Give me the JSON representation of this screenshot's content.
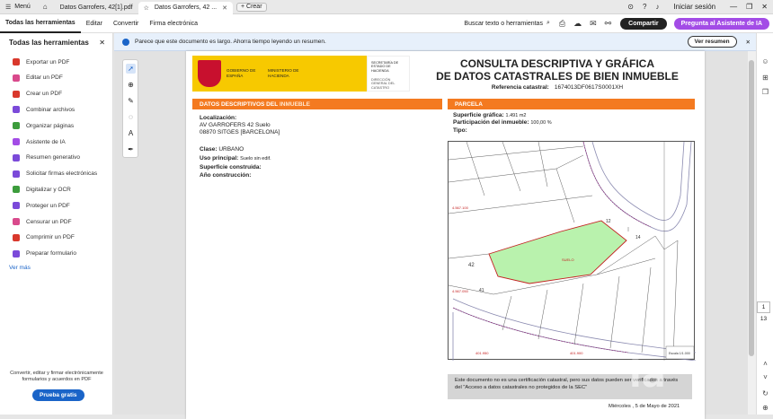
{
  "tabbar": {
    "menu_label": "Menú",
    "tabs": [
      {
        "label": "Datos Garrofers, 42[1].pdf"
      },
      {
        "label": "Datos Garrofers, 42 ..."
      }
    ],
    "new_tab_label": "+ Crear",
    "signin_label": "Iniciar sesión"
  },
  "toolbar": {
    "menu_items": [
      "Todas las herramientas",
      "Editar",
      "Convertir",
      "Firma electrónica"
    ],
    "search_label": "Buscar texto o herramientas",
    "share_label": "Compartir",
    "ai_label": "Pregunta al Asistente de IA"
  },
  "sidebar": {
    "title": "Todas las herramientas",
    "items": [
      {
        "label": "Exportar un PDF",
        "icon": "export-pdf-icon",
        "color": "#d9382c"
      },
      {
        "label": "Editar un PDF",
        "icon": "edit-pdf-icon",
        "color": "#d94a8c"
      },
      {
        "label": "Crear un PDF",
        "icon": "create-pdf-icon",
        "color": "#d9382c"
      },
      {
        "label": "Combinar archivos",
        "icon": "combine-icon",
        "color": "#7b4ad9"
      },
      {
        "label": "Organizar páginas",
        "icon": "organize-icon",
        "color": "#3c9c3c"
      },
      {
        "label": "Asistente de IA",
        "icon": "ai-assistant-icon",
        "color": "#a34ce6"
      },
      {
        "label": "Resumen generativo",
        "icon": "summary-icon",
        "color": "#7b4ad9"
      },
      {
        "label": "Solicitar firmas electrónicas",
        "icon": "request-sign-icon",
        "color": "#7b4ad9"
      },
      {
        "label": "Digitalizar y OCR",
        "icon": "scan-ocr-icon",
        "color": "#3c9c3c"
      },
      {
        "label": "Proteger un PDF",
        "icon": "protect-icon",
        "color": "#7b4ad9"
      },
      {
        "label": "Censurar un PDF",
        "icon": "redact-icon",
        "color": "#d94a8c"
      },
      {
        "label": "Comprimir un PDF",
        "icon": "compress-icon",
        "color": "#d9382c"
      },
      {
        "label": "Preparar formulario",
        "icon": "form-icon",
        "color": "#7b4ad9"
      }
    ],
    "more_label": "Ver más",
    "promo_text": "Convertir, editar y firmar electrónicamente formularios y acuerdos en PDF",
    "trial_label": "Prueba gratis"
  },
  "notice": {
    "text": "Parece que este documento es largo. Ahorra tiempo leyendo un resumen.",
    "button_label": "Ver resumen"
  },
  "document": {
    "logo_gov": "GOBIERNO DE ESPAÑA",
    "logo_min": "MINISTERIO DE HACIENDA",
    "logo_sec": "SECRETARÍA DE ESTADO DE HACIENDA",
    "logo_dir": "DIRECCIÓN GENERAL DEL CATASTRO",
    "title_line1": "CONSULTA DESCRIPTIVA Y GRÁFICA",
    "title_line2": "DE DATOS CATASTRALES DE BIEN INMUEBLE",
    "ref_label": "Referencia catastral:",
    "ref_value": "1674013DF0617S0001XH",
    "section_left_a": "DATOS DESCRIPTIVOS DEL",
    "section_left_b": "INMUEBLE",
    "section_right": "PARCELA",
    "loc_label": "Localización:",
    "loc_line1": "AV GARROFERS 42 Suelo",
    "loc_line2": "08870 SITGES [BARCELONA]",
    "clase_label": "Clase:",
    "clase_value": "URBANO",
    "uso_label": "Uso principal:",
    "uso_value": "Suelo sin edif.",
    "sup_label": "Superficie construida:",
    "ano_label": "Año construcción:",
    "supg_label": "Superficie gráfica:",
    "supg_value": "1.491 m2",
    "part_label": "Participación del inmueble:",
    "part_value": "100,00 %",
    "tipo_label": "Tipo:",
    "map_labels": {
      "suelo": "SUELO",
      "n42": "42",
      "n41": "41",
      "n14": "14",
      "n12": "12",
      "y1": "4.567.100",
      "y2": "4.567.050",
      "x1": "401.950",
      "x2": "401.900",
      "escala": "Escala 1/1.000"
    },
    "disclaimer": "Este documento no es una certificación catastral, pero sus datos pueden ser verificados a través del \"Acceso a datos catastrales no protegidos de la SEC\"",
    "date": "Miércoles , 5 de Mayo de 2021"
  },
  "pagination": {
    "current": "1",
    "total": "13"
  },
  "watermark": "ia"
}
